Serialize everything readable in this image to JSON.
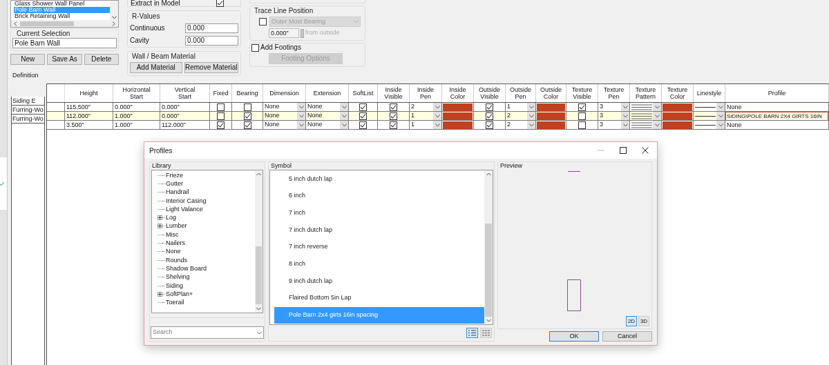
{
  "styles_list": {
    "items": [
      {
        "label": "Glass Shower Wall Panel",
        "selected": false
      },
      {
        "label": "Pole Barn Wall",
        "selected": true
      },
      {
        "label": "Brick Retaining Wall",
        "selected": false
      }
    ]
  },
  "current_selection": {
    "label": "Current Selection",
    "value": "Pole Barn Wall"
  },
  "style_buttons": [
    "New",
    "Save As",
    "Delete"
  ],
  "extract_in_model": {
    "label": "Extract in Model",
    "checked": true
  },
  "r_values": {
    "title": "R-Values",
    "fields": [
      {
        "label": "Continuous",
        "value": "0.000"
      },
      {
        "label": "Cavity",
        "value": "0.000"
      }
    ]
  },
  "material": {
    "title": "Wall / Beam Material",
    "buttons": [
      "Add Material",
      "Remove Material"
    ]
  },
  "trace_line": {
    "title": "Trace Line Position",
    "checked": false,
    "dropdown": "Outer Most Bearing",
    "offset": "0.000\"",
    "offset_note": "from outside"
  },
  "footings": {
    "label": "Add Footings",
    "checked": false,
    "button": "Footing Options"
  },
  "definition": {
    "title": "Definition",
    "columns": [
      {
        "label": "Height",
        "kind": "text"
      },
      {
        "label": "Horizontal\nStart",
        "kind": "text"
      },
      {
        "label": "Vertical\nStart",
        "kind": "text"
      },
      {
        "label": "Fixed",
        "kind": "check"
      },
      {
        "label": "Bearing",
        "kind": "check"
      },
      {
        "label": "Dimension",
        "kind": "combo"
      },
      {
        "label": "Extension",
        "kind": "combo"
      },
      {
        "label": "SoftList",
        "kind": "check"
      },
      {
        "label": "Inside\nVisible",
        "kind": "check"
      },
      {
        "label": "Inside\nPen",
        "kind": "combo"
      },
      {
        "label": "Inside\nColor",
        "kind": "color"
      },
      {
        "label": "Outside\nVisible",
        "kind": "check"
      },
      {
        "label": "Outside\nPen",
        "kind": "combo"
      },
      {
        "label": "Outside\nColor",
        "kind": "color"
      },
      {
        "label": "Texture\nVisible",
        "kind": "check"
      },
      {
        "label": "Texture\nPen",
        "kind": "combo"
      },
      {
        "label": "Texture\nPattern",
        "kind": "pattern"
      },
      {
        "label": "Texture\nColor",
        "kind": "color"
      },
      {
        "label": "Linestyle",
        "kind": "linestyle"
      },
      {
        "label": "Profile",
        "kind": "text"
      }
    ],
    "rows": [
      {
        "label": "Siding E",
        "selected": false,
        "cells": [
          "115.500\"",
          "0.000\"",
          "0.000\"",
          {
            "checked": false
          },
          {
            "checked": false
          },
          "None",
          "None",
          {
            "checked": true
          },
          {
            "checked": true
          },
          "2",
          {
            "color": "#c1401f"
          },
          {
            "checked": true
          },
          "1",
          {
            "color": "#c1401f"
          },
          {
            "checked": true
          },
          "3",
          {
            "color": "#c1401f"
          },
          "None"
        ]
      },
      {
        "label": "Furring-Wo",
        "selected": true,
        "cells": [
          "112.000\"",
          "1.000\"",
          "0.000\"",
          {
            "checked": false
          },
          {
            "checked": true
          },
          "None",
          "None",
          {
            "checked": true
          },
          {
            "checked": true
          },
          "1",
          {
            "color": "#c1401f"
          },
          {
            "checked": true
          },
          "2",
          {
            "color": "#c1401f"
          },
          {
            "checked": false
          },
          "3",
          {
            "color": "#c1401f"
          },
          "SIDING\\POLE BARN 2X4 GIRTS 16IN"
        ]
      },
      {
        "label": "Furring-Wo",
        "selected": false,
        "cells": [
          "3.500\"",
          "1.000\"",
          "112.000\"",
          {
            "checked": true
          },
          {
            "checked": true
          },
          "None",
          "None",
          {
            "checked": true
          },
          {
            "checked": true
          },
          "1",
          {
            "color": "#c1401f"
          },
          {
            "checked": true
          },
          "2",
          {
            "color": "#c1401f"
          },
          {
            "checked": false
          },
          "3",
          {
            "color": "#c1401f"
          },
          "None"
        ]
      }
    ]
  },
  "dialog": {
    "title": "Profiles",
    "library": {
      "title": "Library",
      "items": [
        {
          "label": "Frieze",
          "kind": "leaf"
        },
        {
          "label": "Gutter",
          "kind": "leaf"
        },
        {
          "label": "Handrail",
          "kind": "leaf"
        },
        {
          "label": "Interior Casing",
          "kind": "leaf"
        },
        {
          "label": "Light Valance",
          "kind": "leaf"
        },
        {
          "label": "Log",
          "kind": "folder",
          "expanded": false
        },
        {
          "label": "Lumber",
          "kind": "folder",
          "expanded": false
        },
        {
          "label": "Misc",
          "kind": "leaf"
        },
        {
          "label": "Nailers",
          "kind": "leaf"
        },
        {
          "label": "None",
          "kind": "leaf"
        },
        {
          "label": "Rounds",
          "kind": "leaf"
        },
        {
          "label": "Shadow Board",
          "kind": "leaf"
        },
        {
          "label": "Shelving",
          "kind": "leaf"
        },
        {
          "label": "Siding",
          "kind": "leaf"
        },
        {
          "label": "SoftPlan+",
          "kind": "folder",
          "expanded": false
        },
        {
          "label": "Toerail",
          "kind": "leaf"
        }
      ],
      "search": {
        "placeholder": "Search"
      }
    },
    "symbol": {
      "title": "Symbol",
      "items": [
        {
          "label": "5 inch dutch lap",
          "selected": false
        },
        {
          "label": "6 inch",
          "selected": false
        },
        {
          "label": "7 inch",
          "selected": false
        },
        {
          "label": "7 inch dutch lap",
          "selected": false
        },
        {
          "label": "7 inch reverse",
          "selected": false
        },
        {
          "label": "8 inch",
          "selected": false
        },
        {
          "label": "9 inch dutch lap",
          "selected": false
        },
        {
          "label": "Flaired Bottom 5in Lap",
          "selected": false
        },
        {
          "label": "Pole Barn 2x4 girts 16in spacing",
          "selected": true
        }
      ],
      "view_modes": [
        {
          "kind": "list",
          "selected": true
        },
        {
          "kind": "grid",
          "selected": false
        }
      ]
    },
    "preview": {
      "title": "Preview",
      "modes": [
        {
          "label": "2D",
          "selected": true
        },
        {
          "label": "3D",
          "selected": false
        }
      ]
    },
    "buttons": [
      {
        "label": "OK",
        "default": true
      },
      {
        "label": "Cancel",
        "default": false
      }
    ]
  }
}
